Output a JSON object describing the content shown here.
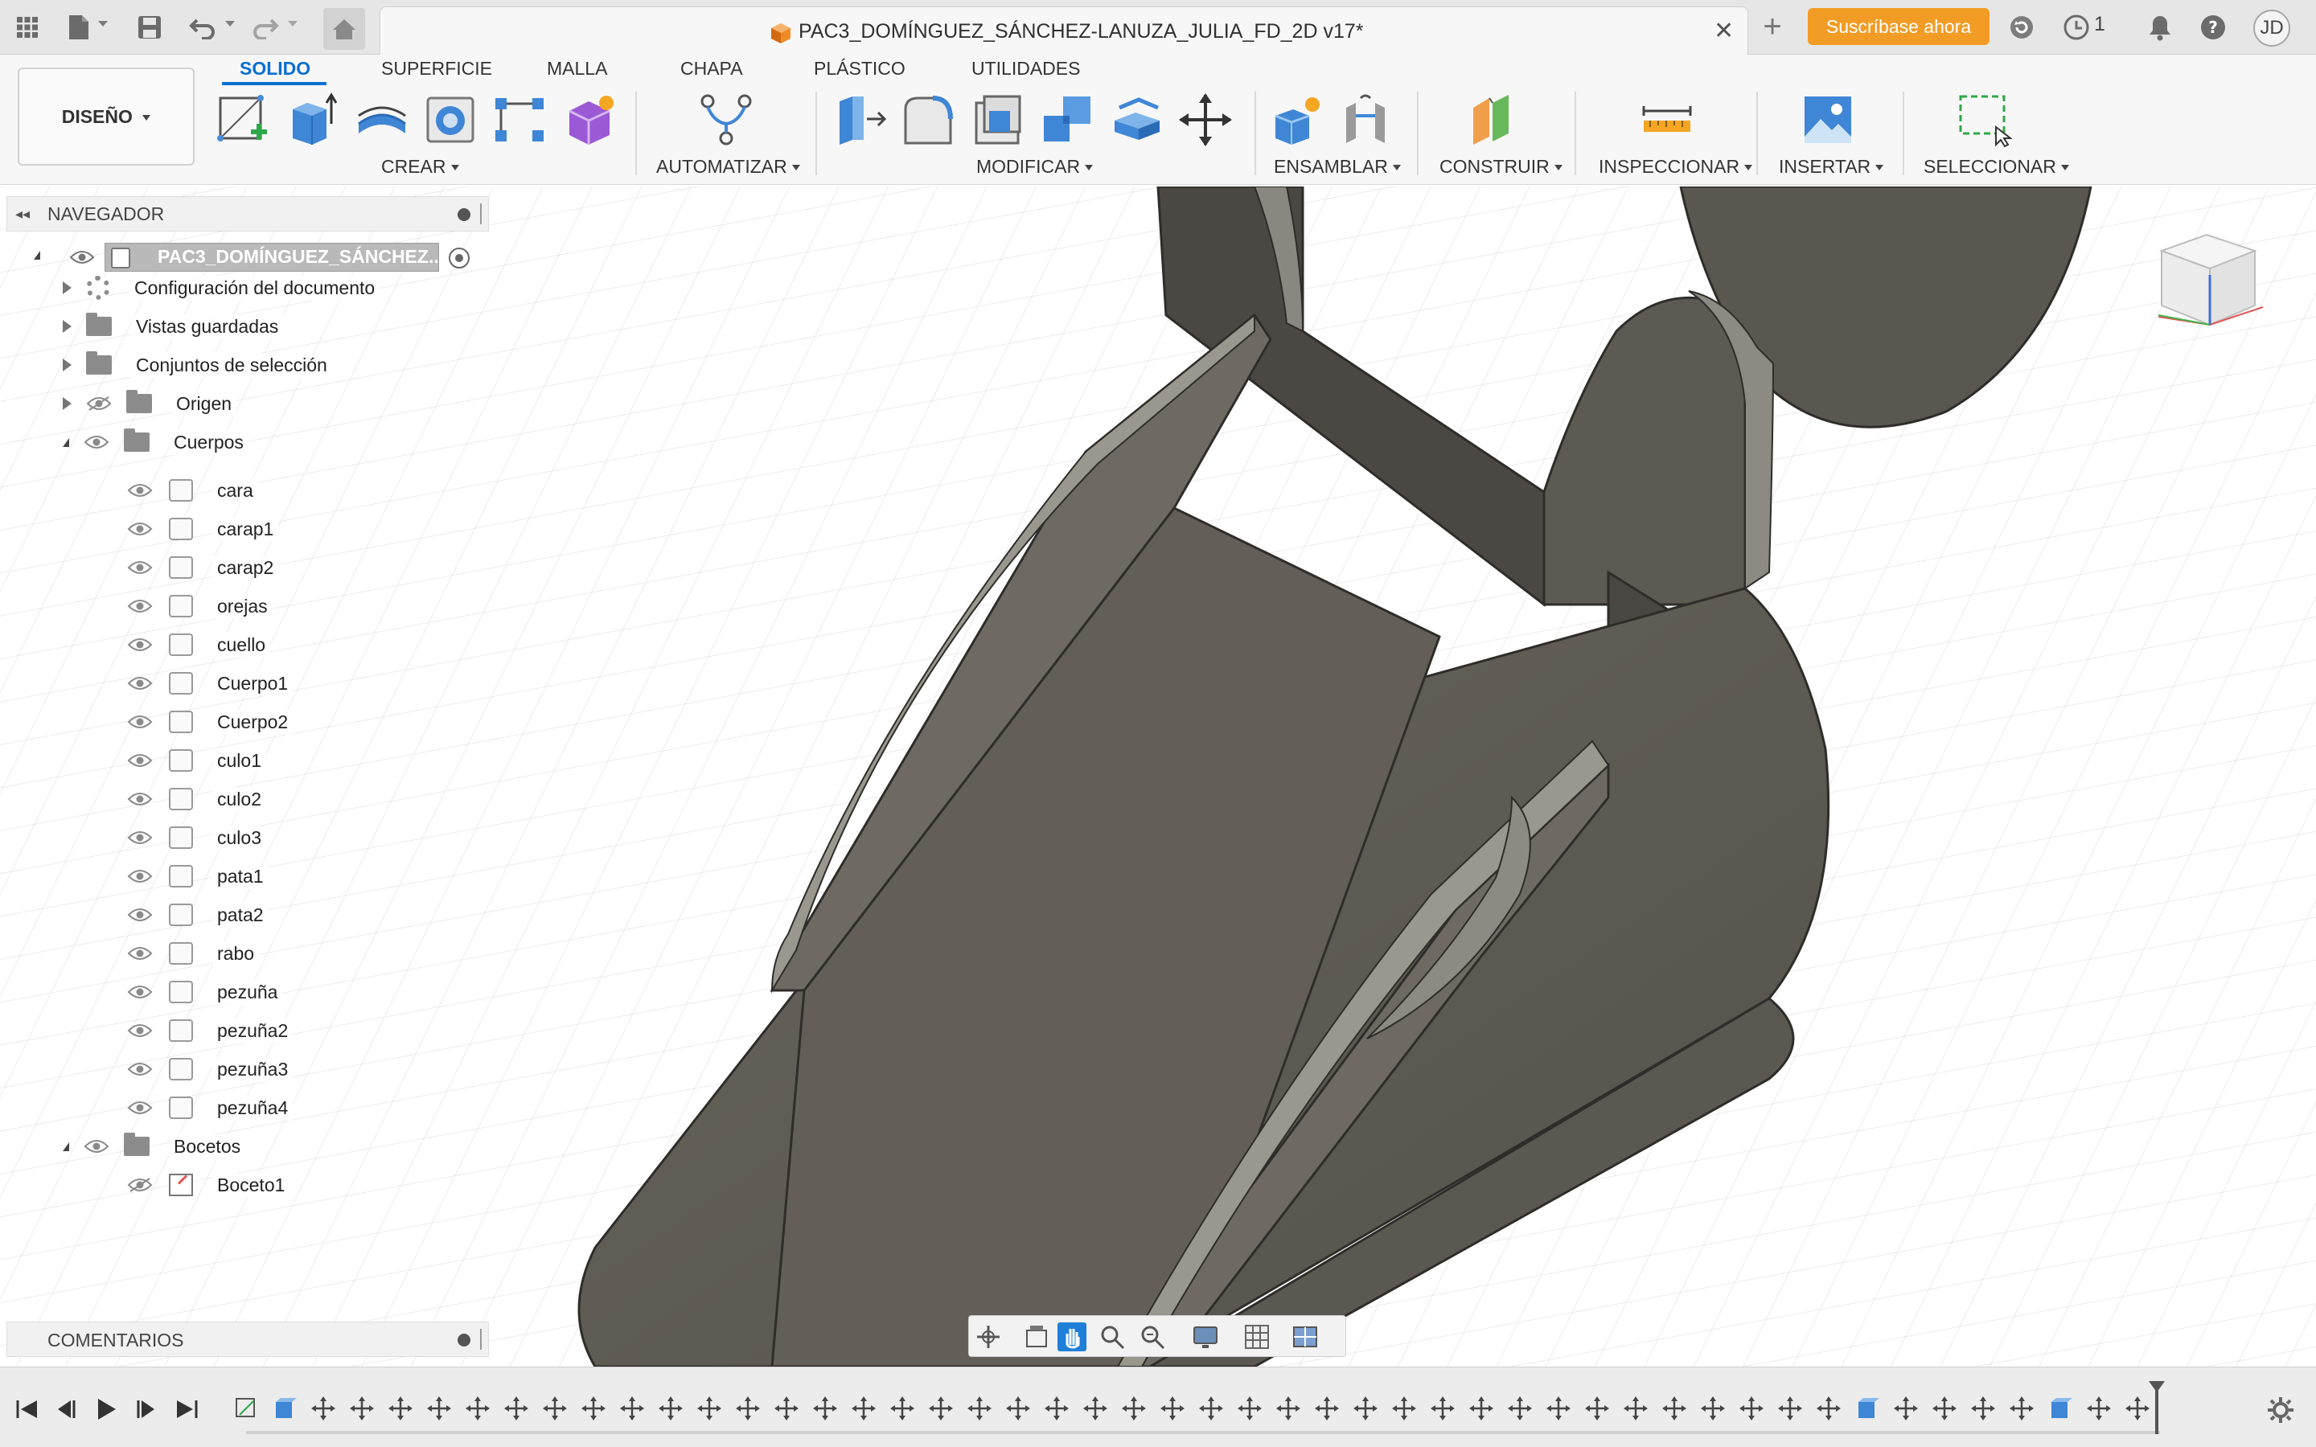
{
  "app": {
    "document_title": "PAC3_DOMÍNGUEZ_SÁNCHEZ-LANUZA_JULIA_FD_2D v17*",
    "subscribe_label": "Suscríbase ahora",
    "jobs_count": "1",
    "user_initials": "JD"
  },
  "workspace_tabs": [
    {
      "label": "SOLIDO",
      "active": true
    },
    {
      "label": "SUPERFICIE",
      "active": false
    },
    {
      "label": "MALLA",
      "active": false
    },
    {
      "label": "CHAPA",
      "active": false
    },
    {
      "label": "PLÁSTICO",
      "active": false
    },
    {
      "label": "UTILIDADES",
      "active": false
    }
  ],
  "design_button": "DISEÑO",
  "ribbon_groups": [
    "CREAR",
    "AUTOMATIZAR",
    "MODIFICAR",
    "ENSAMBLAR",
    "CONSTRUIR",
    "INSPECCIONAR",
    "INSERTAR",
    "SELECCIONAR"
  ],
  "browser": {
    "title": "NAVEGADOR",
    "root": "PAC3_DOMÍNGUEZ_SÁNCHEZ...",
    "items": [
      {
        "label": "Configuración del documento",
        "kind": "settings",
        "expand": "collapsed"
      },
      {
        "label": "Vistas guardadas",
        "kind": "folder",
        "expand": "collapsed"
      },
      {
        "label": "Conjuntos de selección",
        "kind": "folder",
        "expand": "collapsed"
      },
      {
        "label": "Origen",
        "kind": "folder",
        "expand": "collapsed",
        "visible": false
      },
      {
        "label": "Cuerpos",
        "kind": "folder",
        "expand": "expanded",
        "visible": true
      }
    ],
    "bodies": [
      "cara",
      "carap1",
      "carap2",
      "orejas",
      "cuello",
      "Cuerpo1",
      "Cuerpo2",
      "culo1",
      "culo2",
      "culo3",
      "pata1",
      "pata2",
      "rabo",
      "pezuña",
      "pezuña2",
      "pezuña3",
      "pezuña4"
    ],
    "sketch_folder": "Bocetos",
    "sketches": [
      "Boceto1"
    ]
  },
  "comments_title": "COMENTARIOS",
  "colors": {
    "accent": "#0a6fd1",
    "subscribe": "#f39c25",
    "model": "#5e5a53"
  },
  "icons": [
    "grid-menu-icon",
    "file-icon",
    "save-icon",
    "undo-icon",
    "redo-icon",
    "home-icon",
    "refresh-icon",
    "clock-icon",
    "bell-icon",
    "help-icon",
    "view-cube-icon"
  ]
}
